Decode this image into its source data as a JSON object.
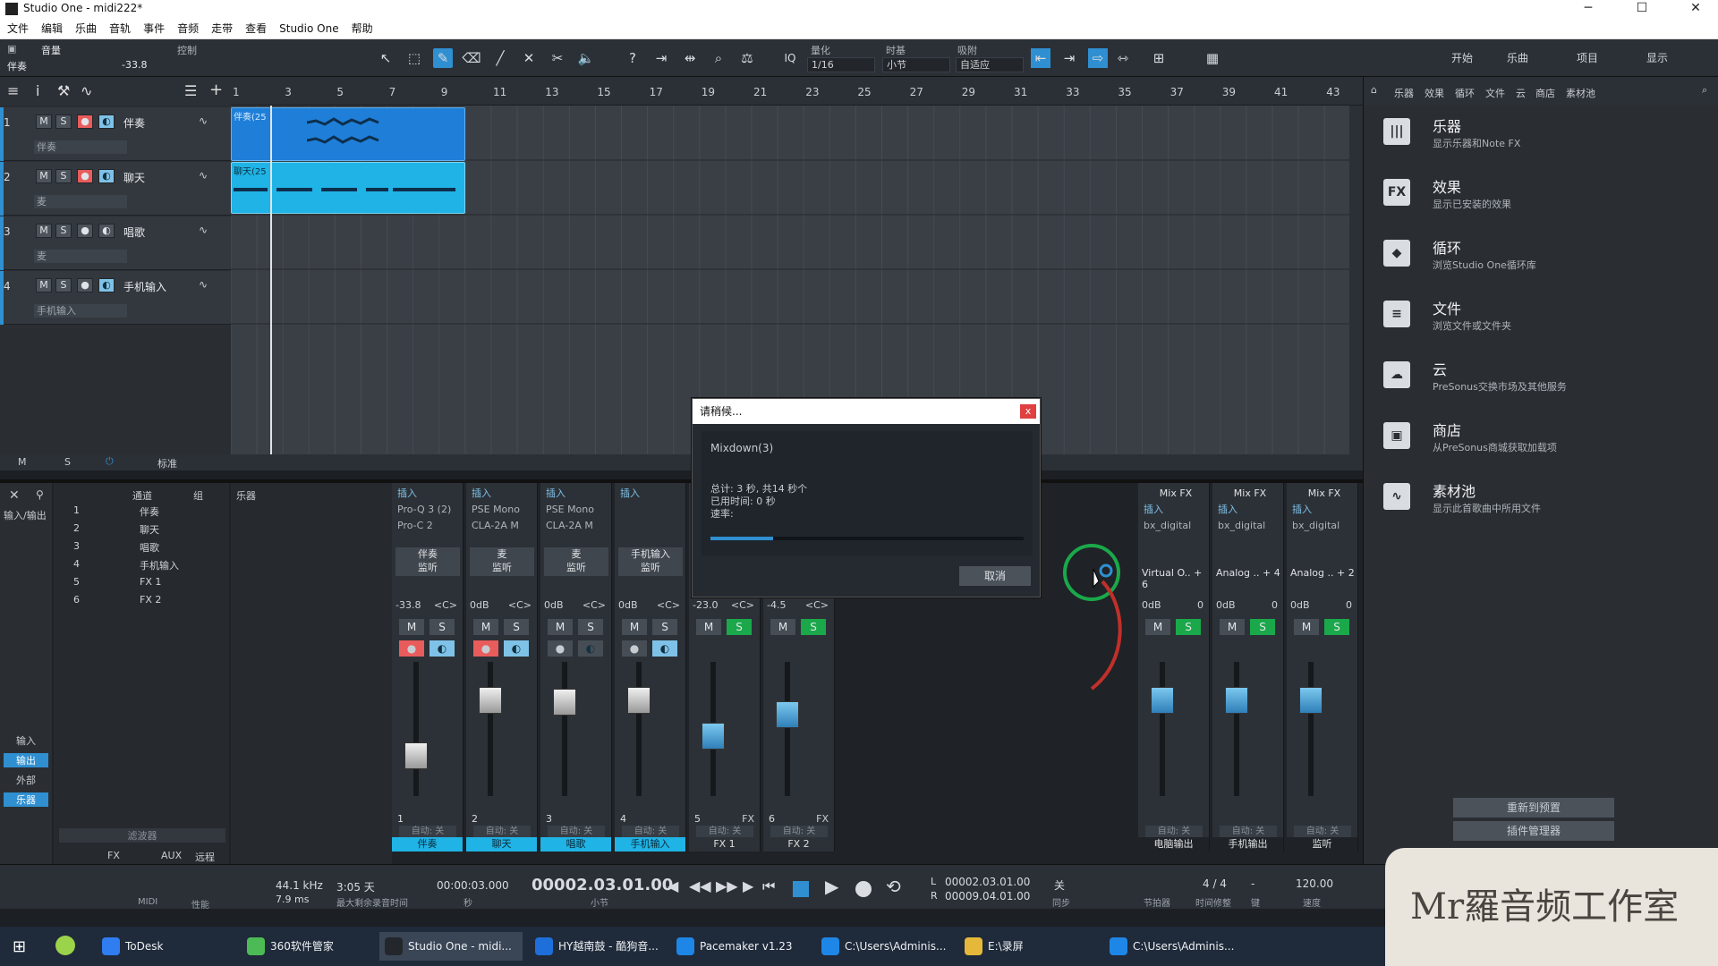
{
  "window": {
    "title": "Studio One - midi222*",
    "minimize": "─",
    "maximize": "☐",
    "close": "✕"
  },
  "menu": [
    "文件",
    "编辑",
    "乐曲",
    "音轨",
    "事件",
    "音频",
    "走带",
    "查看",
    "Studio One",
    "帮助"
  ],
  "toolbar": {
    "track_label": "音量",
    "track_name": "伴奏",
    "control_label": "控制",
    "volume": "-33.8",
    "quantize_label": "量化",
    "quantize_value": "1/16",
    "timebase_label": "时基",
    "timebase_value": "小节",
    "snap_label": "吸附",
    "snap_value": "自适应",
    "nav": [
      "开始",
      "乐曲",
      "项目",
      "显示"
    ],
    "iq": "IQ"
  },
  "ruler": [
    "1",
    "3",
    "5",
    "7",
    "9",
    "11",
    "13",
    "15",
    "17",
    "19",
    "21",
    "23",
    "25",
    "27",
    "29",
    "31",
    "33",
    "35",
    "37",
    "39",
    "41",
    "43"
  ],
  "tracks": [
    {
      "num": "1",
      "name": "伴奏",
      "io": "伴奏",
      "clip": "伴奏(25"
    },
    {
      "num": "2",
      "name": "聊天",
      "io": "麦",
      "clip": "聊天(25"
    },
    {
      "num": "3",
      "name": "唱歌",
      "io": "麦",
      "clip": ""
    },
    {
      "num": "4",
      "name": "手机输入",
      "io": "手机输入",
      "clip": ""
    }
  ],
  "track_buttons": {
    "m": "M",
    "s": "S"
  },
  "bottom_bar": {
    "m": "M",
    "s": "S",
    "std": "标准"
  },
  "dialog": {
    "title": "请稍候...",
    "close": "x",
    "task": "Mixdown(3)",
    "total": "总计: 3 秒, 共14 秒个",
    "elapsed": "已用时间: 0 秒",
    "speed": "速率:",
    "progress": 0.2,
    "cancel": "取消"
  },
  "browser": {
    "tabs": [
      "乐器",
      "效果",
      "循环",
      "文件",
      "云",
      "商店",
      "素材池"
    ],
    "items": [
      {
        "title": "乐器",
        "desc": "显示乐器和Note FX",
        "icon": "|||"
      },
      {
        "title": "效果",
        "desc": "显示已安装的效果",
        "icon": "FX"
      },
      {
        "title": "循环",
        "desc": "浏览Studio One循环库",
        "icon": "◆"
      },
      {
        "title": "文件",
        "desc": "浏览文件或文件夹",
        "icon": "≡"
      },
      {
        "title": "云",
        "desc": "PreSonus交换市场及其他服务",
        "icon": "☁"
      },
      {
        "title": "商店",
        "desc": "从PreSonus商城获取加载项",
        "icon": "▣"
      },
      {
        "title": "素材池",
        "desc": "显示此首歌曲中所用文件",
        "icon": "∿"
      }
    ],
    "reset_btn": "重新到预置",
    "plugin_btn": "插件管理器"
  },
  "mixer_left": {
    "header_channel": "通道",
    "header_group": "组",
    "instrument": "乐器",
    "in_label": "输入/输出",
    "filter": "滤波器",
    "nav_items": [
      "输入",
      "输出",
      "外部",
      "乐器"
    ],
    "bottom": [
      "FX",
      "AUX",
      "远程"
    ],
    "channels": [
      {
        "n": "1",
        "name": "伴奏"
      },
      {
        "n": "2",
        "name": "聊天"
      },
      {
        "n": "3",
        "name": "唱歌"
      },
      {
        "n": "4",
        "name": "手机输入"
      },
      {
        "n": "5",
        "name": "FX 1"
      },
      {
        "n": "6",
        "name": "FX 2"
      }
    ]
  },
  "strips": [
    {
      "slot1": "插入",
      "slot2": "Pro-Q 3 (2)",
      "slot3": "Pro-C 2",
      "in": "伴奏",
      "mon": "监听",
      "vol": "-33.8",
      "pan": "<C>",
      "idx": "1",
      "name": "伴奏",
      "auto": "自动: 关",
      "color": "#1fb3e6"
    },
    {
      "slot1": "插入",
      "slot2": "PSE Mono",
      "slot3": "CLA-2A M",
      "in": "麦",
      "mon": "监听",
      "vol": "0dB",
      "pan": "<C>",
      "idx": "2",
      "name": "聊天",
      "auto": "自动: 关",
      "color": "#1fb3e6"
    },
    {
      "slot1": "插入",
      "slot2": "PSE Mono",
      "slot3": "CLA-2A M",
      "in": "麦",
      "mon": "监听",
      "vol": "0dB",
      "pan": "<C>",
      "idx": "3",
      "name": "唱歌",
      "auto": "自动: 关",
      "color": "#1fb3e6"
    },
    {
      "slot1": "插入",
      "slot2": "",
      "slot3": "",
      "in": "手机输入",
      "mon": "监听",
      "vol": "0dB",
      "pan": "<C>",
      "idx": "4",
      "name": "手机输入",
      "auto": "自动: 关",
      "color": "#1fb3e6"
    },
    {
      "slot1": "",
      "slot2": "",
      "slot3": "",
      "in": "",
      "mon": "",
      "vol": "-23.0",
      "pan": "<C>",
      "idx": "5",
      "name": "FX 1",
      "auto": "自动: 关",
      "color": "#2c3137"
    },
    {
      "slot1": "",
      "slot2": "",
      "slot3": "",
      "in": "",
      "mon": "",
      "vol": "-4.5",
      "pan": "<C>",
      "idx": "6",
      "name": "FX 2",
      "auto": "自动: 关",
      "color": "#2c3137"
    }
  ],
  "fx_tag": "FX",
  "strip_buttons": {
    "m": "M",
    "s": "S"
  },
  "outputs": [
    {
      "mixfx": "Mix FX",
      "slot": "插入",
      "plug": "bx_digital",
      "in": "Virtual O.. + 6",
      "vol": "0dB",
      "pan": "0",
      "name": "电脑输出",
      "auto": "自动: 关"
    },
    {
      "mixfx": "Mix FX",
      "slot": "插入",
      "plug": "bx_digital",
      "in": "Analog .. + 4",
      "vol": "0dB",
      "pan": "0",
      "name": "手机输出",
      "auto": "自动: 关"
    },
    {
      "mixfx": "Mix FX",
      "slot": "插入",
      "plug": "bx_digital",
      "in": "Analog .. + 2",
      "vol": "0dB",
      "pan": "0",
      "name": "监听",
      "auto": "自动: 关"
    }
  ],
  "transport": {
    "midi": "MIDI",
    "perf": "性能",
    "rate": "44.1 kHz",
    "latency": "7.9 ms",
    "remain": "3:05 天",
    "remain_lbl": "最大剩余录音时间",
    "sec": "00:00:03.000",
    "sec_lbl": "秒",
    "bars": "00002.03.01.00",
    "bars_lbl": "小节",
    "L": "00002.03.01.00",
    "R": "00009.04.01.00",
    "sync": "关",
    "sync_lbl": "同步",
    "metro_lbl": "节拍器",
    "sig": "4 / 4",
    "sig_lbl": "时间修整",
    "key_lbl": "键",
    "key": "-",
    "tempo": "120.00",
    "tempo_lbl": "速度"
  },
  "taskbar": [
    {
      "label": "ToDesk",
      "color": "#2f7df0"
    },
    {
      "label": "360软件管家",
      "color": "#4cbb55"
    },
    {
      "label": "Studio One - midi...",
      "color": "#23272c"
    },
    {
      "label": "HY越南鼓 - 酷狗音...",
      "color": "#1e6fd9"
    },
    {
      "label": "Pacemaker v1.23",
      "color": "#1e86e6"
    },
    {
      "label": "C:\\Users\\Adminis...",
      "color": "#1e86e6"
    },
    {
      "label": "E:\\录屏",
      "color": "#e5b83a"
    },
    {
      "label": "C:\\Users\\Adminis...",
      "color": "#1e86e6"
    }
  ],
  "watermark": "Mr羅音频工作室"
}
